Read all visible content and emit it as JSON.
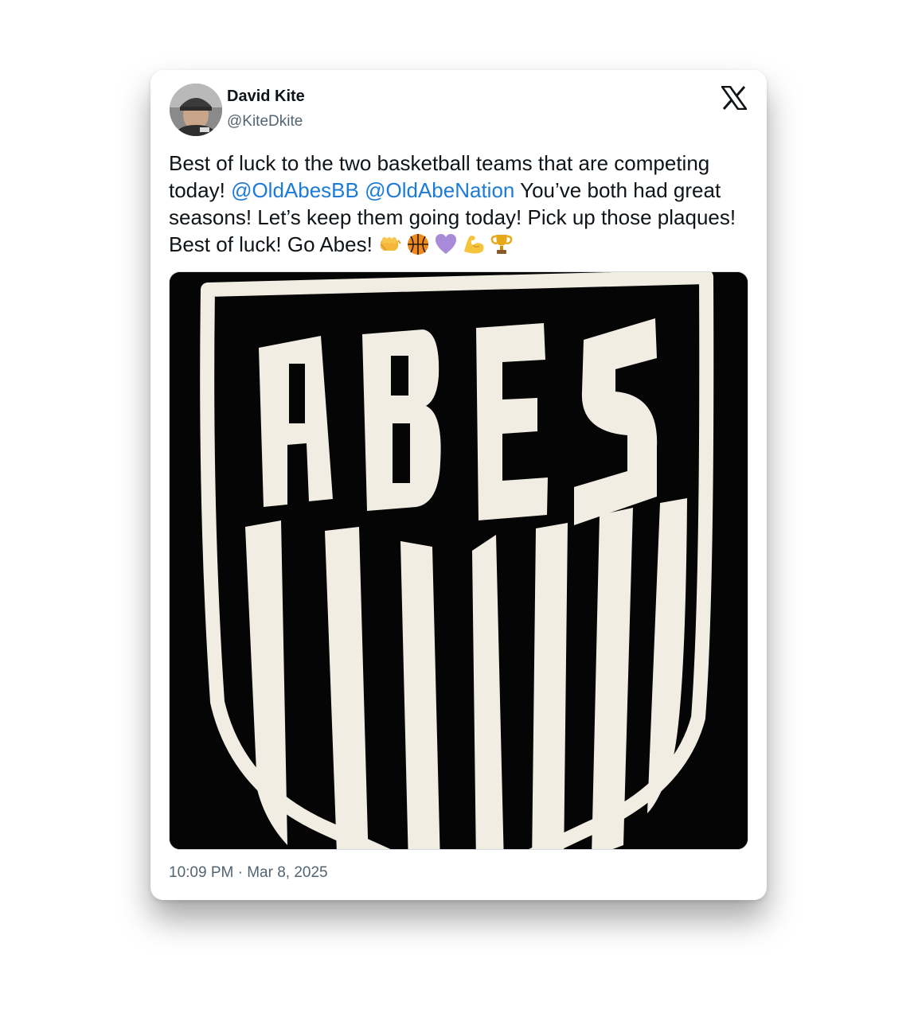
{
  "author": {
    "name": "David Kite",
    "handle": "@KiteDkite"
  },
  "platform_icon": "x-logo-icon",
  "tweet": {
    "text_1": "Best of luck to the two basketball teams that are competing today! ",
    "mention_1": "@OldAbesBB",
    "space": " ",
    "mention_2": "@OldAbeNation",
    "text_2": " You’ve both had great seasons! Let’s keep them going today! Pick up those plaques! Best of luck! Go Abes! ",
    "emojis": [
      "oncoming-fist-icon",
      "basketball-icon",
      "purple-heart-icon",
      "flexed-biceps-icon",
      "trophy-icon"
    ]
  },
  "media": {
    "logo_text": "ABES"
  },
  "timestamp": "10:09 PM · Mar 8, 2025",
  "colors": {
    "link": "#1d7bd8",
    "text": "#0f1419",
    "secondary": "#536471",
    "shield_cream": "#f2ede3",
    "background_black": "#050505"
  }
}
